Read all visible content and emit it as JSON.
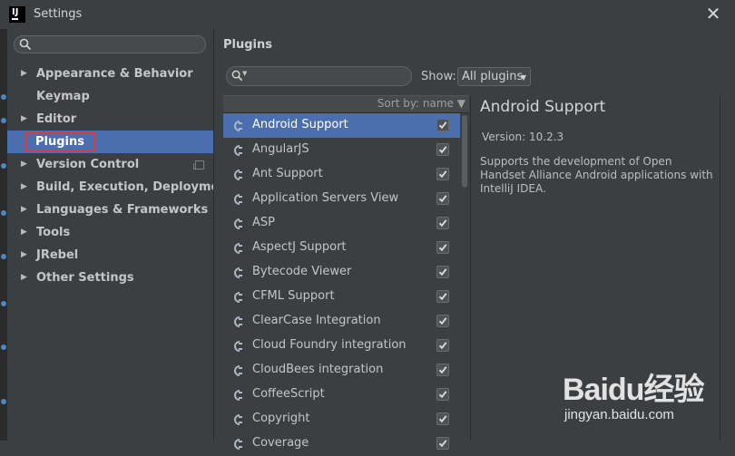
{
  "window": {
    "title": "Settings",
    "close_glyph": "✕"
  },
  "sidebar": {
    "search_value": "",
    "items": [
      {
        "label": "Appearance & Behavior",
        "expandable": true
      },
      {
        "label": "Keymap",
        "expandable": false
      },
      {
        "label": "Editor",
        "expandable": true
      },
      {
        "label": "Plugins",
        "expandable": false,
        "selected": true
      },
      {
        "label": "Version Control",
        "expandable": true,
        "copy_icon": true
      },
      {
        "label": "Build, Execution, Deployment",
        "expandable": true
      },
      {
        "label": "Languages & Frameworks",
        "expandable": true
      },
      {
        "label": "Tools",
        "expandable": true
      },
      {
        "label": "JRebel",
        "expandable": true
      },
      {
        "label": "Other Settings",
        "expandable": true
      }
    ]
  },
  "plugins": {
    "section_title": "Plugins",
    "search_value": "",
    "show_label": "Show:",
    "show_selected": "All plugins",
    "sort_label": "Sort by: name ▼",
    "list": [
      {
        "name": "Android Support",
        "checked": true,
        "selected": true
      },
      {
        "name": "AngularJS",
        "checked": true
      },
      {
        "name": "Ant Support",
        "checked": true
      },
      {
        "name": "Application Servers View",
        "checked": true
      },
      {
        "name": "ASP",
        "checked": true
      },
      {
        "name": "AspectJ Support",
        "checked": true
      },
      {
        "name": "Bytecode Viewer",
        "checked": true
      },
      {
        "name": "CFML Support",
        "checked": true
      },
      {
        "name": "ClearCase Integration",
        "checked": true
      },
      {
        "name": "Cloud Foundry integration",
        "checked": true
      },
      {
        "name": "CloudBees integration",
        "checked": true
      },
      {
        "name": "CoffeeScript",
        "checked": true
      },
      {
        "name": "Copyright",
        "checked": true
      },
      {
        "name": "Coverage",
        "checked": true
      }
    ]
  },
  "detail": {
    "title": "Android Support",
    "version": "Version: 10.2.3",
    "description": "Supports the development of Open Handset Alliance Android applications with IntelliJ IDEA."
  },
  "watermark": {
    "logo": "Baidu经验",
    "url": "jingyan.baidu.com"
  },
  "colors": {
    "selection": "#4b6eaf",
    "highlight_border": "#e03a3a",
    "background": "#3c3f41"
  }
}
